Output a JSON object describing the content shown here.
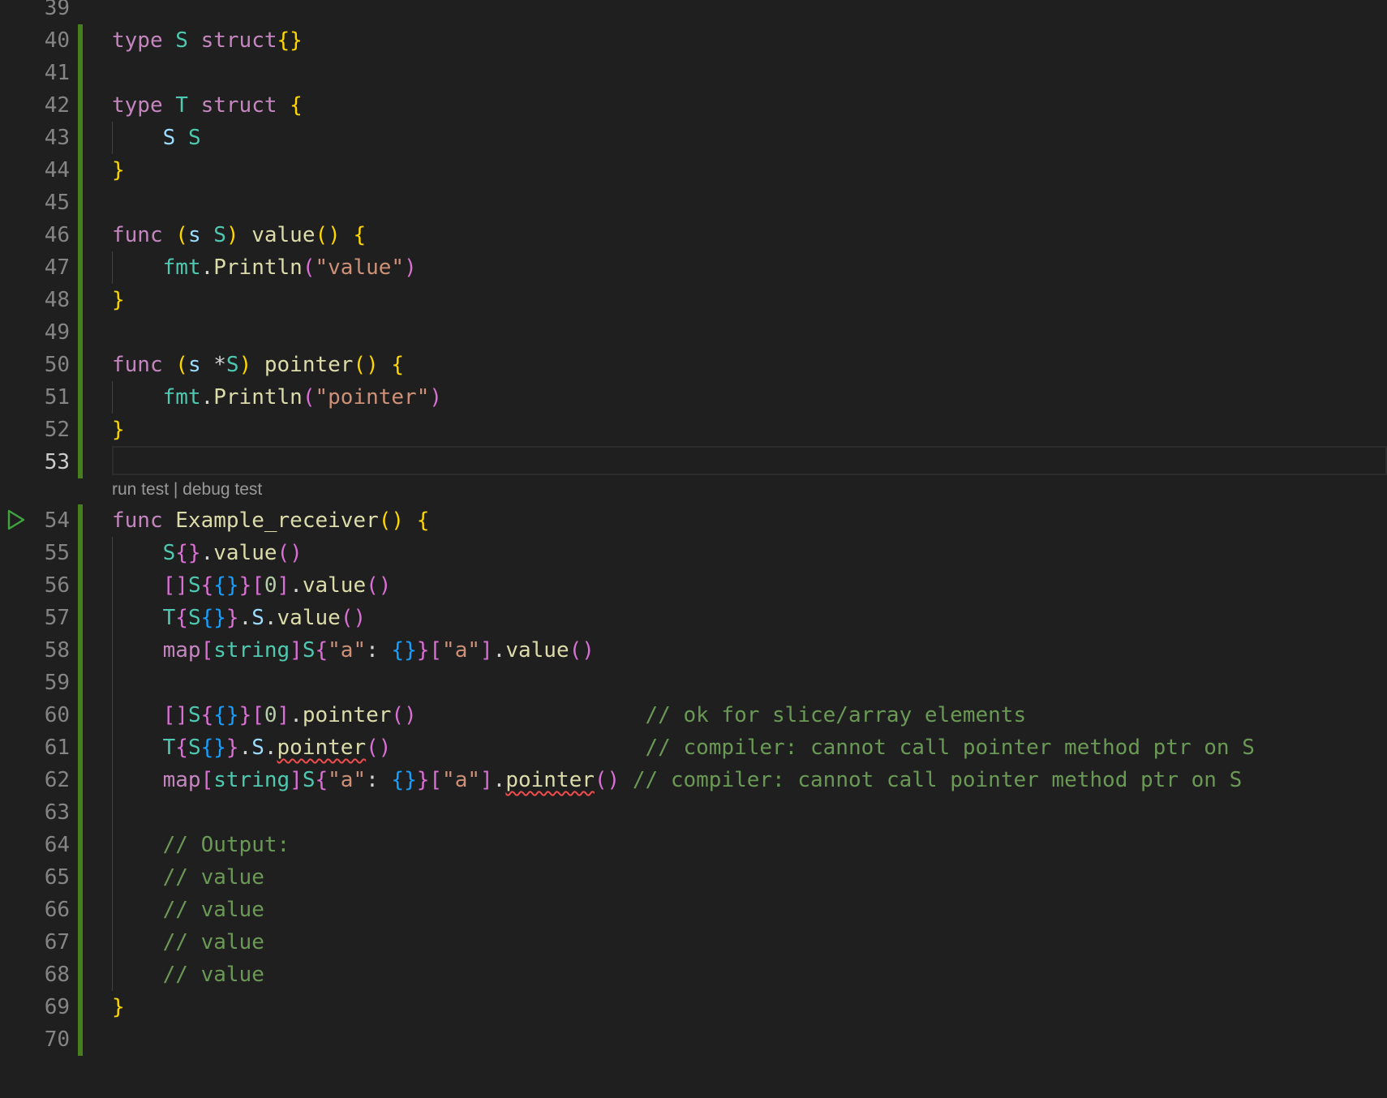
{
  "editor": {
    "first_line_number": "39",
    "codelens": {
      "run": "run test",
      "separator": " | ",
      "debug": "debug test"
    },
    "lines": [
      {
        "n": "39",
        "tokens": []
      },
      {
        "n": "40",
        "tokens": [
          {
            "t": "type",
            "c": "kw"
          },
          {
            "t": " ",
            "c": "pl"
          },
          {
            "t": "S",
            "c": "ty"
          },
          {
            "t": " ",
            "c": "pl"
          },
          {
            "t": "struct",
            "c": "kw"
          },
          {
            "t": "{}",
            "c": "br1"
          }
        ]
      },
      {
        "n": "41",
        "tokens": []
      },
      {
        "n": "42",
        "tokens": [
          {
            "t": "type",
            "c": "kw"
          },
          {
            "t": " ",
            "c": "pl"
          },
          {
            "t": "T",
            "c": "ty"
          },
          {
            "t": " ",
            "c": "pl"
          },
          {
            "t": "struct",
            "c": "kw"
          },
          {
            "t": " ",
            "c": "pl"
          },
          {
            "t": "{",
            "c": "br1"
          }
        ]
      },
      {
        "n": "43",
        "tokens": [
          {
            "t": "    ",
            "c": "pl"
          },
          {
            "t": "S",
            "c": "var"
          },
          {
            "t": " ",
            "c": "pl"
          },
          {
            "t": "S",
            "c": "ty"
          }
        ]
      },
      {
        "n": "44",
        "tokens": [
          {
            "t": "}",
            "c": "br1"
          }
        ]
      },
      {
        "n": "45",
        "tokens": []
      },
      {
        "n": "46",
        "tokens": [
          {
            "t": "func",
            "c": "kw"
          },
          {
            "t": " ",
            "c": "pl"
          },
          {
            "t": "(",
            "c": "br1"
          },
          {
            "t": "s",
            "c": "var"
          },
          {
            "t": " ",
            "c": "pl"
          },
          {
            "t": "S",
            "c": "ty"
          },
          {
            "t": ")",
            "c": "br1"
          },
          {
            "t": " ",
            "c": "pl"
          },
          {
            "t": "value",
            "c": "fn"
          },
          {
            "t": "()",
            "c": "br1"
          },
          {
            "t": " ",
            "c": "pl"
          },
          {
            "t": "{",
            "c": "br1"
          }
        ]
      },
      {
        "n": "47",
        "tokens": [
          {
            "t": "    ",
            "c": "pl"
          },
          {
            "t": "fmt",
            "c": "ty"
          },
          {
            "t": ".",
            "c": "pl"
          },
          {
            "t": "Println",
            "c": "fn"
          },
          {
            "t": "(",
            "c": "br2"
          },
          {
            "t": "\"value\"",
            "c": "str"
          },
          {
            "t": ")",
            "c": "br2"
          }
        ]
      },
      {
        "n": "48",
        "tokens": [
          {
            "t": "}",
            "c": "br1"
          }
        ]
      },
      {
        "n": "49",
        "tokens": []
      },
      {
        "n": "50",
        "tokens": [
          {
            "t": "func",
            "c": "kw"
          },
          {
            "t": " ",
            "c": "pl"
          },
          {
            "t": "(",
            "c": "br1"
          },
          {
            "t": "s",
            "c": "var"
          },
          {
            "t": " ",
            "c": "pl"
          },
          {
            "t": "*",
            "c": "pl"
          },
          {
            "t": "S",
            "c": "ty"
          },
          {
            "t": ")",
            "c": "br1"
          },
          {
            "t": " ",
            "c": "pl"
          },
          {
            "t": "pointer",
            "c": "fn"
          },
          {
            "t": "()",
            "c": "br1"
          },
          {
            "t": " ",
            "c": "pl"
          },
          {
            "t": "{",
            "c": "br1"
          }
        ]
      },
      {
        "n": "51",
        "tokens": [
          {
            "t": "    ",
            "c": "pl"
          },
          {
            "t": "fmt",
            "c": "ty"
          },
          {
            "t": ".",
            "c": "pl"
          },
          {
            "t": "Println",
            "c": "fn"
          },
          {
            "t": "(",
            "c": "br2"
          },
          {
            "t": "\"pointer\"",
            "c": "str"
          },
          {
            "t": ")",
            "c": "br2"
          }
        ]
      },
      {
        "n": "52",
        "tokens": [
          {
            "t": "}",
            "c": "br1"
          }
        ]
      },
      {
        "n": "53",
        "tokens": [],
        "active": true
      },
      {
        "n": "54",
        "tokens": [
          {
            "t": "func",
            "c": "kw"
          },
          {
            "t": " ",
            "c": "pl"
          },
          {
            "t": "Example_receiver",
            "c": "fn"
          },
          {
            "t": "()",
            "c": "br1"
          },
          {
            "t": " ",
            "c": "pl"
          },
          {
            "t": "{",
            "c": "br1"
          }
        ]
      },
      {
        "n": "55",
        "tokens": [
          {
            "t": "    ",
            "c": "pl"
          },
          {
            "t": "S",
            "c": "ty"
          },
          {
            "t": "{}",
            "c": "br2"
          },
          {
            "t": ".",
            "c": "pl"
          },
          {
            "t": "value",
            "c": "fn"
          },
          {
            "t": "()",
            "c": "br2"
          }
        ]
      },
      {
        "n": "56",
        "tokens": [
          {
            "t": "    ",
            "c": "pl"
          },
          {
            "t": "[]",
            "c": "br2"
          },
          {
            "t": "S",
            "c": "ty"
          },
          {
            "t": "{",
            "c": "br2"
          },
          {
            "t": "{}",
            "c": "br3"
          },
          {
            "t": "}",
            "c": "br2"
          },
          {
            "t": "[",
            "c": "br2"
          },
          {
            "t": "0",
            "c": "num"
          },
          {
            "t": "]",
            "c": "br2"
          },
          {
            "t": ".",
            "c": "pl"
          },
          {
            "t": "value",
            "c": "fn"
          },
          {
            "t": "()",
            "c": "br2"
          }
        ]
      },
      {
        "n": "57",
        "tokens": [
          {
            "t": "    ",
            "c": "pl"
          },
          {
            "t": "T",
            "c": "ty"
          },
          {
            "t": "{",
            "c": "br2"
          },
          {
            "t": "S",
            "c": "ty"
          },
          {
            "t": "{}",
            "c": "br3"
          },
          {
            "t": "}",
            "c": "br2"
          },
          {
            "t": ".",
            "c": "pl"
          },
          {
            "t": "S",
            "c": "var"
          },
          {
            "t": ".",
            "c": "pl"
          },
          {
            "t": "value",
            "c": "fn"
          },
          {
            "t": "()",
            "c": "br2"
          }
        ]
      },
      {
        "n": "58",
        "tokens": [
          {
            "t": "    ",
            "c": "pl"
          },
          {
            "t": "map",
            "c": "kw"
          },
          {
            "t": "[",
            "c": "br2"
          },
          {
            "t": "string",
            "c": "ty"
          },
          {
            "t": "]",
            "c": "br2"
          },
          {
            "t": "S",
            "c": "ty"
          },
          {
            "t": "{",
            "c": "br2"
          },
          {
            "t": "\"a\"",
            "c": "str"
          },
          {
            "t": ": ",
            "c": "pl"
          },
          {
            "t": "{}",
            "c": "br3"
          },
          {
            "t": "}",
            "c": "br2"
          },
          {
            "t": "[",
            "c": "br2"
          },
          {
            "t": "\"a\"",
            "c": "str"
          },
          {
            "t": "]",
            "c": "br2"
          },
          {
            "t": ".",
            "c": "pl"
          },
          {
            "t": "value",
            "c": "fn"
          },
          {
            "t": "()",
            "c": "br2"
          }
        ]
      },
      {
        "n": "59",
        "tokens": []
      },
      {
        "n": "60",
        "tokens": [
          {
            "t": "    ",
            "c": "pl"
          },
          {
            "t": "[]",
            "c": "br2"
          },
          {
            "t": "S",
            "c": "ty"
          },
          {
            "t": "{",
            "c": "br2"
          },
          {
            "t": "{}",
            "c": "br3"
          },
          {
            "t": "}",
            "c": "br2"
          },
          {
            "t": "[",
            "c": "br2"
          },
          {
            "t": "0",
            "c": "num"
          },
          {
            "t": "]",
            "c": "br2"
          },
          {
            "t": ".",
            "c": "pl"
          },
          {
            "t": "pointer",
            "c": "fn"
          },
          {
            "t": "()",
            "c": "br2"
          },
          {
            "t": "                  ",
            "c": "pl"
          },
          {
            "t": "// ok for slice/array elements",
            "c": "cm"
          }
        ]
      },
      {
        "n": "61",
        "tokens": [
          {
            "t": "    ",
            "c": "pl"
          },
          {
            "t": "T",
            "c": "ty"
          },
          {
            "t": "{",
            "c": "br2"
          },
          {
            "t": "S",
            "c": "ty"
          },
          {
            "t": "{}",
            "c": "br3"
          },
          {
            "t": "}",
            "c": "br2"
          },
          {
            "t": ".",
            "c": "pl"
          },
          {
            "t": "S",
            "c": "var"
          },
          {
            "t": ".",
            "c": "pl"
          },
          {
            "t": "pointer",
            "c": "fn",
            "err": true
          },
          {
            "t": "()",
            "c": "br2"
          },
          {
            "t": "                    ",
            "c": "pl"
          },
          {
            "t": "// compiler: cannot call pointer method ptr on S",
            "c": "cm"
          }
        ]
      },
      {
        "n": "62",
        "tokens": [
          {
            "t": "    ",
            "c": "pl"
          },
          {
            "t": "map",
            "c": "kw"
          },
          {
            "t": "[",
            "c": "br2"
          },
          {
            "t": "string",
            "c": "ty"
          },
          {
            "t": "]",
            "c": "br2"
          },
          {
            "t": "S",
            "c": "ty"
          },
          {
            "t": "{",
            "c": "br2"
          },
          {
            "t": "\"a\"",
            "c": "str"
          },
          {
            "t": ": ",
            "c": "pl"
          },
          {
            "t": "{}",
            "c": "br3"
          },
          {
            "t": "}",
            "c": "br2"
          },
          {
            "t": "[",
            "c": "br2"
          },
          {
            "t": "\"a\"",
            "c": "str"
          },
          {
            "t": "]",
            "c": "br2"
          },
          {
            "t": ".",
            "c": "pl"
          },
          {
            "t": "pointer",
            "c": "fn",
            "err": true
          },
          {
            "t": "()",
            "c": "br2"
          },
          {
            "t": " ",
            "c": "pl"
          },
          {
            "t": "// compiler: cannot call pointer method ptr on S",
            "c": "cm"
          }
        ]
      },
      {
        "n": "63",
        "tokens": []
      },
      {
        "n": "64",
        "tokens": [
          {
            "t": "    ",
            "c": "pl"
          },
          {
            "t": "// Output:",
            "c": "cm"
          }
        ]
      },
      {
        "n": "65",
        "tokens": [
          {
            "t": "    ",
            "c": "pl"
          },
          {
            "t": "// value",
            "c": "cm"
          }
        ]
      },
      {
        "n": "66",
        "tokens": [
          {
            "t": "    ",
            "c": "pl"
          },
          {
            "t": "// value",
            "c": "cm"
          }
        ]
      },
      {
        "n": "67",
        "tokens": [
          {
            "t": "    ",
            "c": "pl"
          },
          {
            "t": "// value",
            "c": "cm"
          }
        ]
      },
      {
        "n": "68",
        "tokens": [
          {
            "t": "    ",
            "c": "pl"
          },
          {
            "t": "// value",
            "c": "cm"
          }
        ]
      },
      {
        "n": "69",
        "tokens": [
          {
            "t": "}",
            "c": "br1"
          }
        ]
      },
      {
        "n": "70",
        "tokens": []
      }
    ]
  }
}
